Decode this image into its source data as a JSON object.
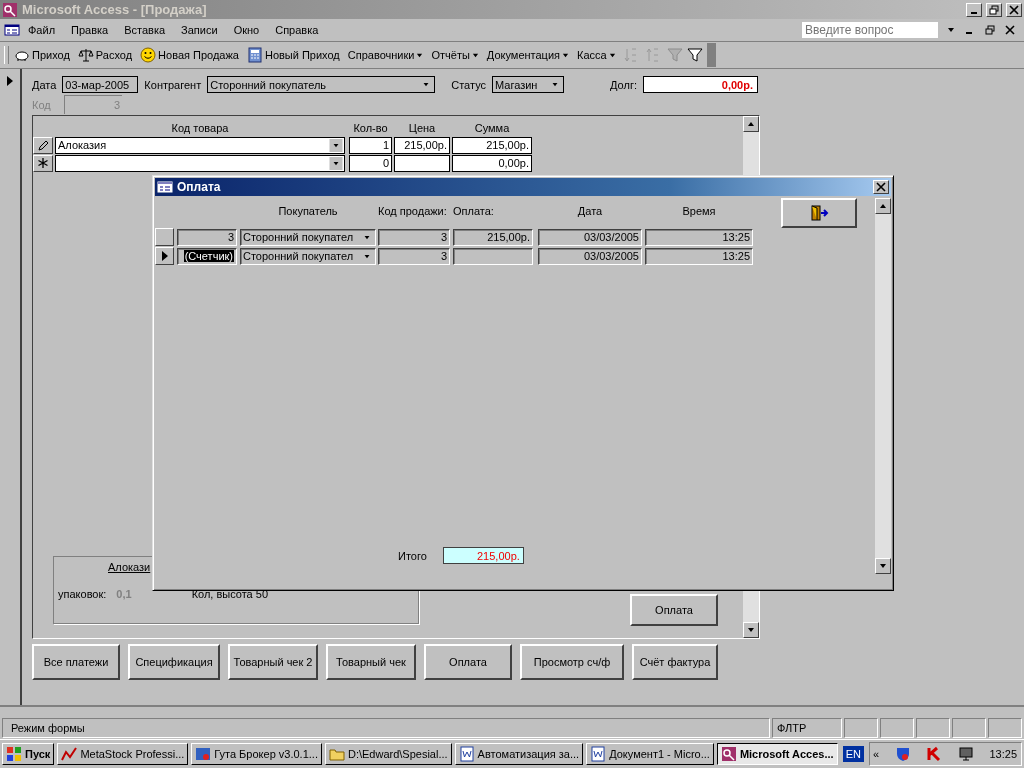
{
  "window": {
    "title": "Microsoft Access - [Продажа]"
  },
  "menu": [
    "Файл",
    "Правка",
    "Вставка",
    "Записи",
    "Окно",
    "Справка"
  ],
  "help_search": {
    "placeholder": "Введите вопрос"
  },
  "toolbar": [
    {
      "label": "Приход",
      "kind": "piggy"
    },
    {
      "label": "Расход",
      "kind": "scales"
    },
    {
      "label": "Новая Продажа",
      "kind": "smiley"
    },
    {
      "label": "Новый Приход",
      "kind": "calculator"
    },
    {
      "label": "Справочники",
      "kind": "menu"
    },
    {
      "label": "Отчёты",
      "kind": "menu"
    },
    {
      "label": "Документация",
      "kind": "menu"
    },
    {
      "label": "Касса",
      "kind": "menu"
    }
  ],
  "form": {
    "date_label": "Дата",
    "date": "03-мар-2005",
    "counterparty_label": "Контрагент",
    "counterparty": "Сторонний покупатель",
    "status_label": "Статус",
    "status": "Магазин",
    "debt_label": "Долг:",
    "debt": "0,00р.",
    "code_label": "Код",
    "code": "3",
    "code_disabled": true
  },
  "subform": {
    "columns": [
      "Код товара",
      "Кол-во",
      "Цена",
      "Сумма"
    ],
    "rows": [
      {
        "kind": "edit",
        "product": "Алоказия",
        "qty": "1",
        "price": "215,00р.",
        "sum": "215,00р."
      },
      {
        "kind": "new",
        "qty": "0",
        "sum": "0,00р."
      }
    ],
    "info": {
      "title": "Алокази",
      "pack_label": "упаковок:",
      "pack": "0,1",
      "note": "Кол, высота 50"
    },
    "pay_button": "Оплата"
  },
  "buttons": [
    "Все платежи",
    "Спецификация",
    "Товарный чек 2",
    "Товарный чек",
    "Оплата",
    "Просмотр сч/ф",
    "Счёт фактура"
  ],
  "dialog": {
    "title": "Оплата",
    "columns": [
      "Покупатель",
      "Код продажи:",
      "Оплата:",
      "Дата",
      "Время"
    ],
    "rows": [
      {
        "counter": "3",
        "buyer": "Сторонний покупател",
        "sale_code": "3",
        "payment": "215,00р.",
        "date": "03/03/2005",
        "time": "13:25",
        "current": false
      },
      {
        "counter": "(Счетчик)",
        "buyer": "Сторонний покупател",
        "sale_code": "3",
        "date": "03/03/2005",
        "time": "13:25",
        "current": true
      }
    ],
    "total_label": "Итого",
    "total": "215,00р."
  },
  "status_bar": {
    "mode": "Режим формы",
    "filter": "ФЛТР"
  },
  "taskbar": {
    "start": "Пуск",
    "tasks": [
      {
        "label": "MetaStock Professi...",
        "kind": "chart",
        "selected": false
      },
      {
        "label": "Гута Брокер v3.0.1...",
        "kind": "app",
        "selected": false
      },
      {
        "label": "D:\\Edward\\Spesial...",
        "kind": "folder",
        "selected": false
      },
      {
        "label": "Автоматизация за...",
        "kind": "word",
        "selected": false
      },
      {
        "label": "Документ1 - Micro...",
        "kind": "word",
        "selected": false
      },
      {
        "label": "Microsoft Acces...",
        "kind": "access",
        "selected": true
      }
    ],
    "language": "EN",
    "chevron": "«",
    "clock": "13:25"
  }
}
